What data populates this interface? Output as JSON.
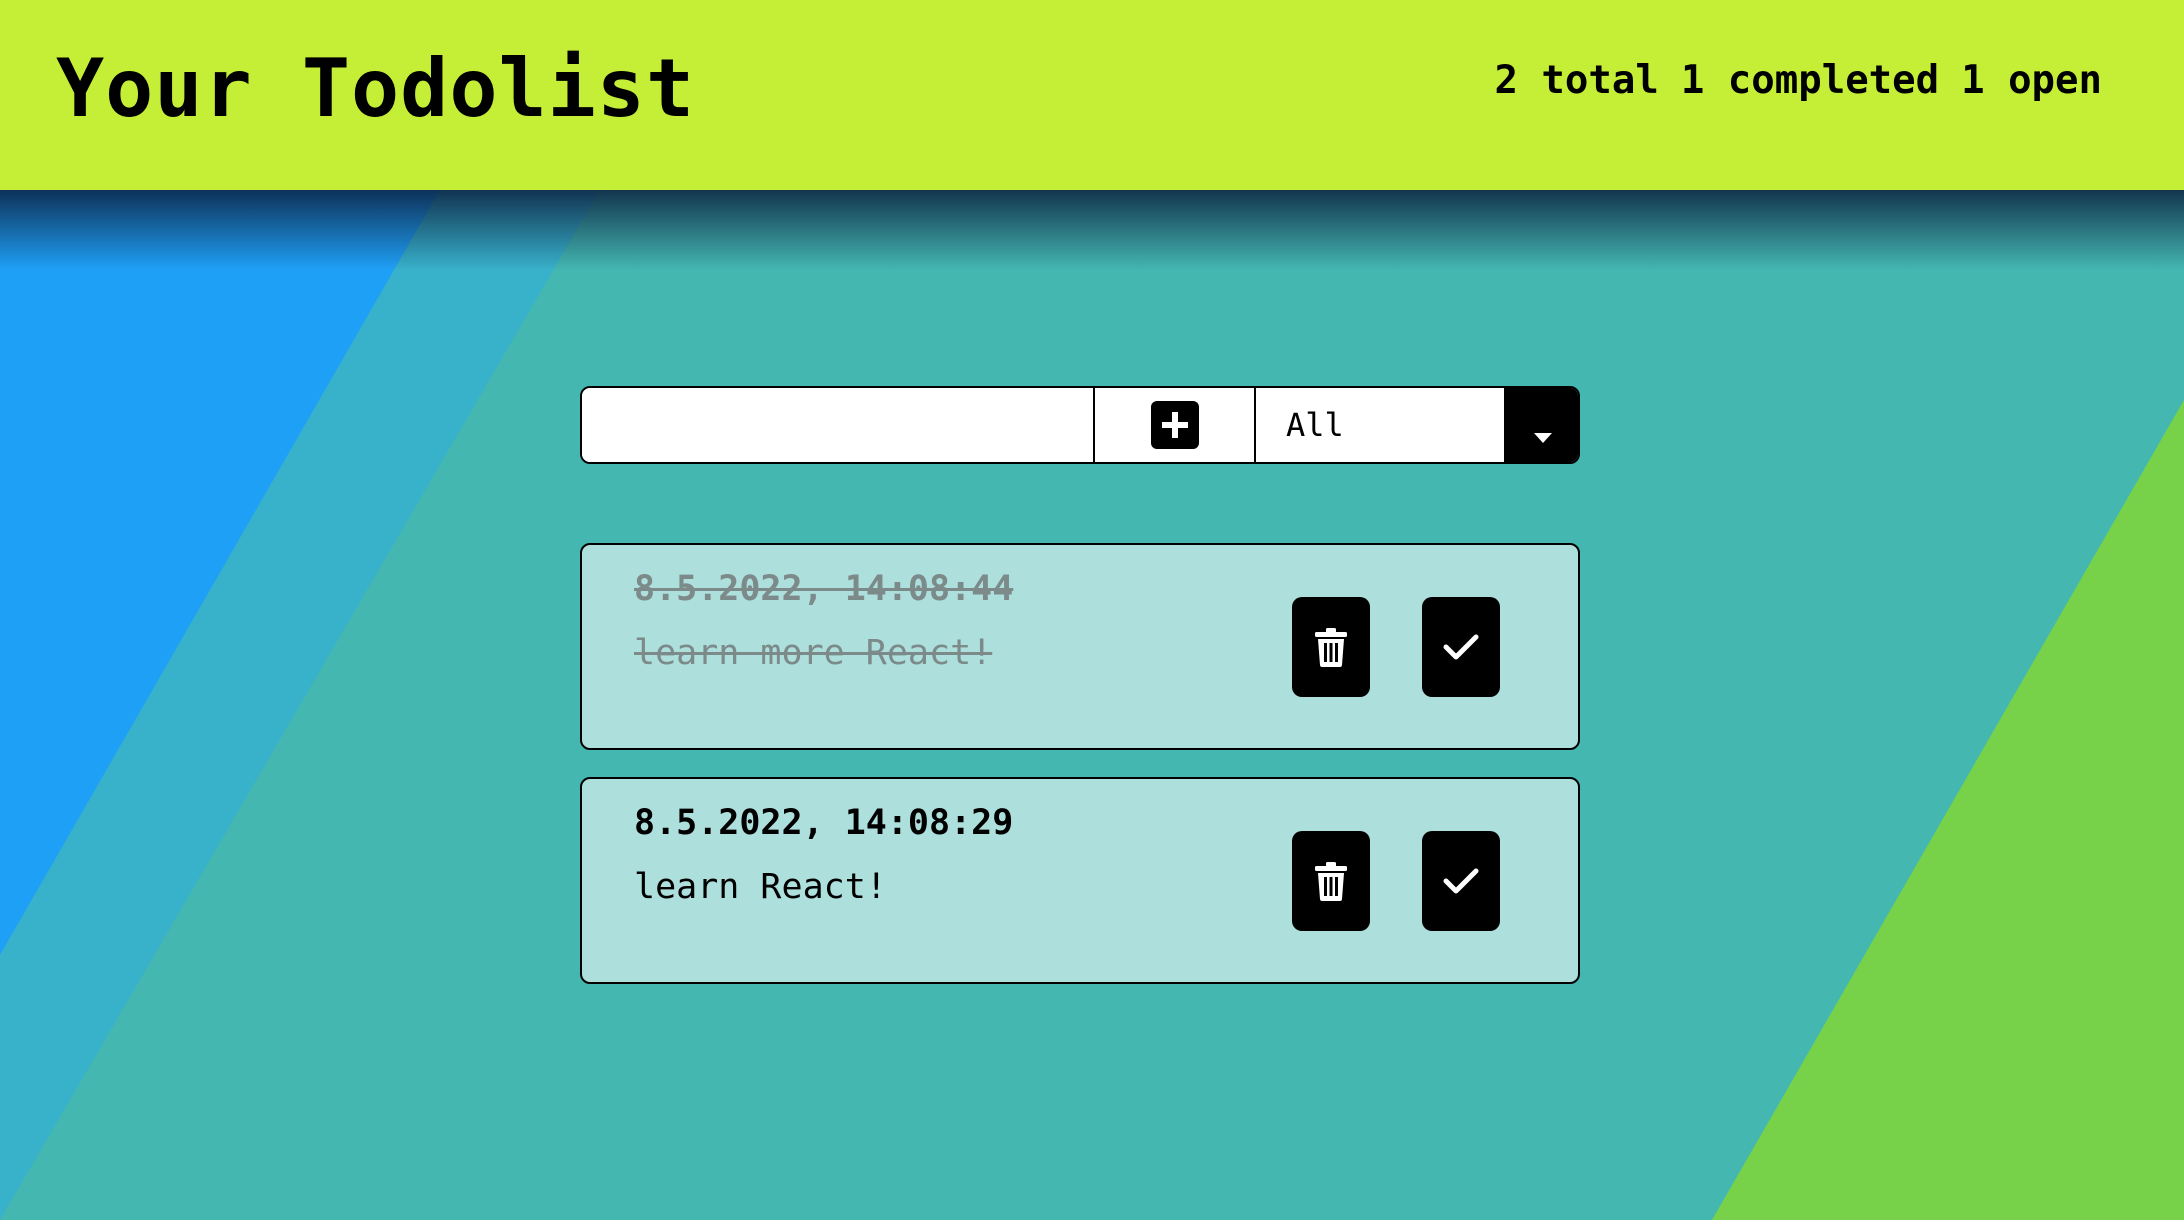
{
  "header": {
    "title": "Your Todolist",
    "stats": {
      "total_label": "2 total",
      "completed_label": "1 completed",
      "open_label": "1 open"
    }
  },
  "controls": {
    "input_value": "",
    "add_icon": "plus-icon",
    "filter_selected": "All",
    "filter_icon": "caret-down-icon"
  },
  "todos": [
    {
      "date": "8.5.2022, 14:08:44",
      "text": "learn more React!",
      "completed": true
    },
    {
      "date": "8.5.2022, 14:08:29",
      "text": "learn React!",
      "completed": false
    }
  ],
  "colors": {
    "header_bg": "#c5ef36",
    "background_teal": "#44b7b1",
    "background_blue": "#1fa0f7",
    "background_green": "#77d24a",
    "card_bg": "#addfdd"
  }
}
